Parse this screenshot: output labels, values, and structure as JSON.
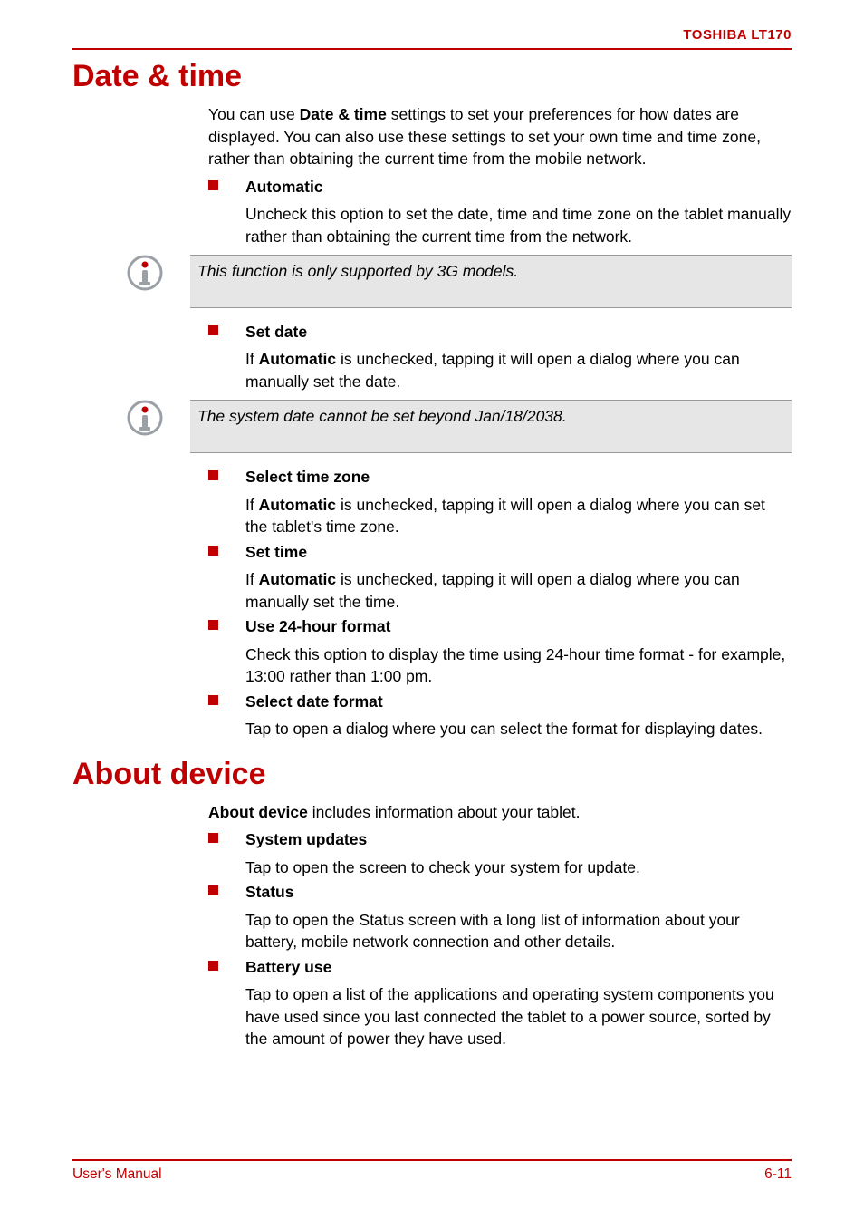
{
  "header": {
    "product": "TOSHIBA LT170"
  },
  "section1": {
    "title": "Date & time",
    "intro_pre": "You can use ",
    "intro_bold": "Date & time",
    "intro_post": " settings to set your preferences for how dates are displayed. You can also use these settings to set your own time and time zone, rather than obtaining the current time from the mobile network.",
    "items": {
      "automatic": {
        "title": "Automatic",
        "desc": "Uncheck this option to set the date, time and time zone on the tablet manually rather than obtaining the current time from the network."
      },
      "setdate": {
        "title": "Set date",
        "desc_pre": "If ",
        "desc_bold": "Automatic",
        "desc_post": " is unchecked, tapping it will open a dialog where you can manually set the date."
      },
      "selecttz": {
        "title": "Select time zone",
        "desc_pre": "If ",
        "desc_bold": "Automatic",
        "desc_post": " is unchecked, tapping it will open a dialog where you can set the tablet's time zone."
      },
      "settime": {
        "title": "Set time",
        "desc_pre": "If ",
        "desc_bold": "Automatic",
        "desc_post": " is unchecked, tapping it will open a dialog where you can manually set the time."
      },
      "use24": {
        "title": "Use 24-hour format",
        "desc": "Check this option to display the time using 24-hour time format - for example, 13:00 rather than 1:00 pm."
      },
      "seldatefmt": {
        "title": "Select date format",
        "desc": "Tap to open a dialog where you can select the format for displaying dates."
      }
    },
    "note1": "This function is only supported by 3G models.",
    "note2": "The system date cannot be set beyond Jan/18/2038."
  },
  "section2": {
    "title": "About device",
    "intro_bold": "About device",
    "intro_post": " includes information about your tablet.",
    "items": {
      "sysupd": {
        "title": "System updates",
        "desc": "Tap to open the screen to check your system for update."
      },
      "status": {
        "title": "Status",
        "desc": "Tap to open the Status screen with a long list of information about your battery, mobile network connection and other details."
      },
      "battery": {
        "title": "Battery use",
        "desc": "Tap to open a list of the applications and operating system components you have used since you last connected the tablet to a power source, sorted by the amount of power they have used."
      }
    }
  },
  "footer": {
    "left": "User's Manual",
    "right": "6-11"
  }
}
